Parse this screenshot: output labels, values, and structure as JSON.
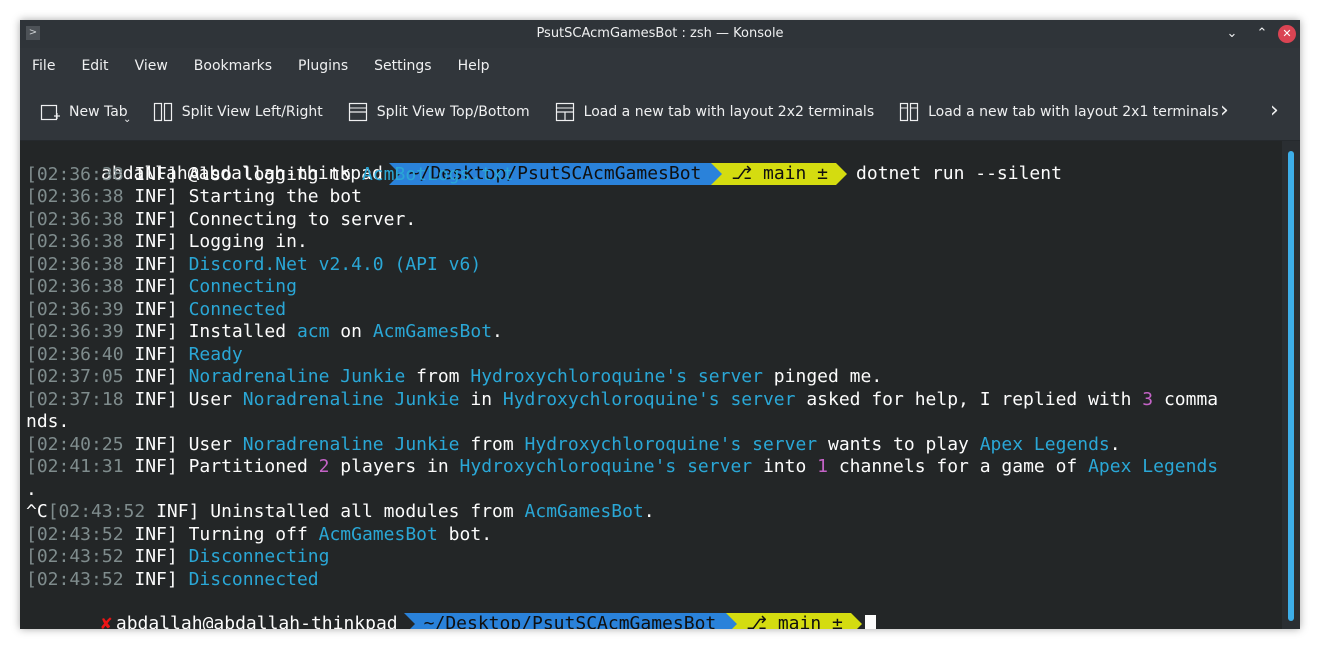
{
  "window": {
    "title": "PsutSCAcmGamesBot : zsh — Konsole",
    "app_icon": ">",
    "minimize": "⌄",
    "maximize": "⌃",
    "close": "✕"
  },
  "menu": [
    "File",
    "Edit",
    "View",
    "Bookmarks",
    "Plugins",
    "Settings",
    "Help"
  ],
  "toolbar": {
    "new_tab": "New Tab",
    "split_lr": "Split View Left/Right",
    "split_tb": "Split View Top/Bottom",
    "layout_2x2": "Load a new tab with layout 2x2 terminals",
    "layout_2x1": "Load a new tab with layout 2x1 terminals",
    "dropdown": "⌄",
    "more": "›"
  },
  "prompt": {
    "user": "abdallah@abdallah-thinkpad",
    "path": "~/Desktop/PsutSCAcmGamesBot",
    "branch_icon": "⎇",
    "branch": "main ±",
    "command": "dotnet run --silent",
    "error_mark": "✘"
  },
  "log": [
    {
      "ts": "[02:36:38",
      "lvl": " INF] ",
      "parts": [
        [
          "t",
          "Also logging to "
        ],
        [
          "c",
          "AcmBotLogs.txt"
        ]
      ]
    },
    {
      "ts": "[02:36:38",
      "lvl": " INF] ",
      "parts": [
        [
          "t",
          "Starting the bot"
        ]
      ]
    },
    {
      "ts": "[02:36:38",
      "lvl": " INF] ",
      "parts": [
        [
          "t",
          "Connecting to server."
        ]
      ]
    },
    {
      "ts": "[02:36:38",
      "lvl": " INF] ",
      "parts": [
        [
          "t",
          "Logging in."
        ]
      ]
    },
    {
      "ts": "[02:36:38",
      "lvl": " INF] ",
      "parts": [
        [
          "c",
          "Discord.Net v2.4.0 (API v6)"
        ]
      ]
    },
    {
      "ts": "[02:36:38",
      "lvl": " INF] ",
      "parts": [
        [
          "c",
          "Connecting"
        ]
      ]
    },
    {
      "ts": "[02:36:39",
      "lvl": " INF] ",
      "parts": [
        [
          "c",
          "Connected"
        ]
      ]
    },
    {
      "ts": "[02:36:39",
      "lvl": " INF] ",
      "parts": [
        [
          "t",
          "Installed "
        ],
        [
          "c",
          "acm"
        ],
        [
          "t",
          " on "
        ],
        [
          "c",
          "AcmGamesBot"
        ],
        [
          "t",
          "."
        ]
      ]
    },
    {
      "ts": "[02:36:40",
      "lvl": " INF] ",
      "parts": [
        [
          "c",
          "Ready"
        ]
      ]
    },
    {
      "ts": "[02:37:05",
      "lvl": " INF] ",
      "parts": [
        [
          "c",
          "Noradrenaline Junkie"
        ],
        [
          "t",
          " from "
        ],
        [
          "c",
          "Hydroxychloroquine's server"
        ],
        [
          "t",
          " pinged me."
        ]
      ]
    },
    {
      "ts": "[02:37:18",
      "lvl": " INF] ",
      "parts": [
        [
          "t",
          "User "
        ],
        [
          "c",
          "Noradrenaline Junkie"
        ],
        [
          "t",
          " in "
        ],
        [
          "c",
          "Hydroxychloroquine's server"
        ],
        [
          "t",
          " asked for help, I replied with "
        ],
        [
          "m",
          "3"
        ],
        [
          "t",
          " comma"
        ]
      ]
    },
    {
      "ts": "",
      "lvl": "",
      "parts": [
        [
          "t",
          "nds."
        ]
      ]
    },
    {
      "ts": "[02:40:25",
      "lvl": " INF] ",
      "parts": [
        [
          "t",
          "User "
        ],
        [
          "c",
          "Noradrenaline Junkie"
        ],
        [
          "t",
          " from "
        ],
        [
          "c",
          "Hydroxychloroquine's server"
        ],
        [
          "t",
          " wants to play "
        ],
        [
          "c",
          "Apex Legends"
        ],
        [
          "t",
          "."
        ]
      ]
    },
    {
      "ts": "[02:41:31",
      "lvl": " INF] ",
      "parts": [
        [
          "t",
          "Partitioned "
        ],
        [
          "m",
          "2"
        ],
        [
          "t",
          " players in "
        ],
        [
          "c",
          "Hydroxychloroquine's server"
        ],
        [
          "t",
          " into "
        ],
        [
          "m",
          "1"
        ],
        [
          "t",
          " channels for a game of "
        ],
        [
          "c",
          "Apex Legends"
        ]
      ]
    },
    {
      "ts": "",
      "lvl": "",
      "parts": [
        [
          "t",
          "."
        ]
      ]
    },
    {
      "ts": "[02:43:52",
      "lvl": " INF] ",
      "prefix": "^C",
      "parts": [
        [
          "t",
          "Uninstalled all modules from "
        ],
        [
          "c",
          "AcmGamesBot"
        ],
        [
          "t",
          "."
        ]
      ]
    },
    {
      "ts": "[02:43:52",
      "lvl": " INF] ",
      "parts": [
        [
          "t",
          "Turning off "
        ],
        [
          "c",
          "AcmGamesBot"
        ],
        [
          "t",
          " bot."
        ]
      ]
    },
    {
      "ts": "[02:43:52",
      "lvl": " INF] ",
      "parts": [
        [
          "c",
          "Disconnecting"
        ]
      ]
    },
    {
      "ts": "[02:43:52",
      "lvl": " INF] ",
      "parts": [
        [
          "c",
          "Disconnected"
        ]
      ]
    }
  ]
}
